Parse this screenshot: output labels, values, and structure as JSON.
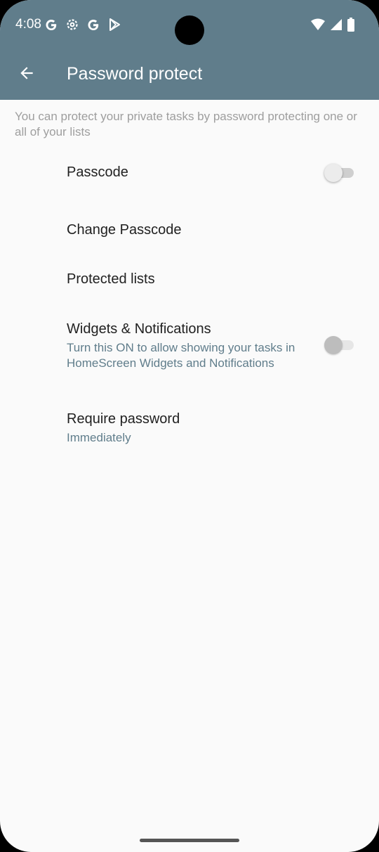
{
  "status_bar": {
    "time": "4:08",
    "left_icons": [
      "google-g-icon",
      "settings-gear-icon",
      "google-g-icon",
      "play-store-icon"
    ],
    "right_icons": [
      "wifi-icon",
      "cell-signal-icon",
      "battery-icon"
    ]
  },
  "app_bar": {
    "title": "Password protect",
    "back_icon": "arrow-back-icon",
    "color": "#607d8b"
  },
  "description": "You can protect your private tasks by password protecting one or all of your lists",
  "preferences": [
    {
      "title": "Passcode",
      "switch": false
    },
    {
      "title": "Change Passcode"
    },
    {
      "title": "Protected lists"
    },
    {
      "title": "Widgets & Notifications",
      "summary": "Turn this ON to allow showing your tasks in HomeScreen Widgets and Notifications",
      "switch": false
    },
    {
      "title": "Require password",
      "summary": "Immediately"
    }
  ],
  "colors": {
    "summary": "#607d8b",
    "description": "#9e9e9e"
  }
}
